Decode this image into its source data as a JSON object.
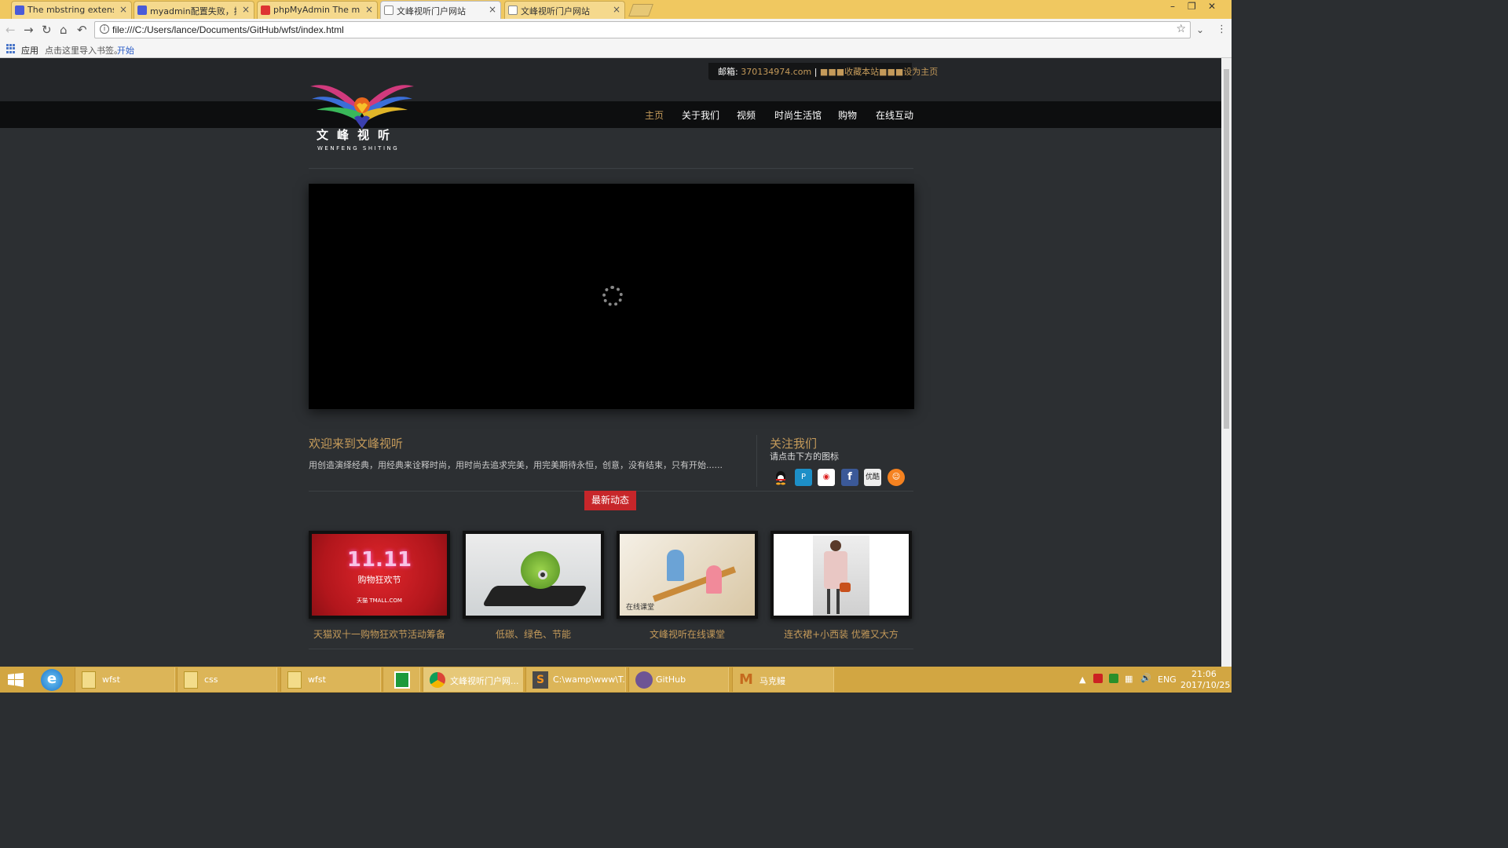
{
  "browser": {
    "tabs": [
      {
        "title": "The mbstring extensio",
        "active": false
      },
      {
        "title": "myadmin配置失败，提示",
        "active": false
      },
      {
        "title": "phpMyAdmin The mbs",
        "active": false
      },
      {
        "title": "文峰视听门户网站",
        "active": true
      },
      {
        "title": "文峰视听门户网站",
        "active": false
      }
    ],
    "close_glyph": "×",
    "url": "file:///C:/Users/lance/Documents/GitHub/wfst/index.html",
    "bookmarks": {
      "apps": "应用",
      "import_hint": "点击这里导入书签。",
      "start": "开始"
    }
  },
  "site": {
    "topbar": {
      "mail_label": "邮箱:",
      "mail_value": "370134974.com",
      "separator": "|",
      "links": "■■■收藏本站■■■设为主页"
    },
    "logo": {
      "name": "文峰视听",
      "subtitle": "WENFENG SHITING"
    },
    "nav": [
      "主页",
      "关于我们",
      "视频",
      "时尚生活馆",
      "购物",
      "在线互动"
    ],
    "welcome": {
      "title": "欢迎来到文峰视听",
      "text": "用创造演绎经典，用经典来诠释时尚，用时尚去追求完美，用完美期待永恒，创意，没有结束，只有开始......"
    },
    "follow": {
      "title": "关注我们",
      "subtitle": "请点击下方的图标",
      "icons": [
        "qq-icon",
        "pp-icon",
        "weibo-icon",
        "facebook-icon",
        "youku-icon",
        "renren-icon"
      ],
      "youku_label": "优酷"
    },
    "latest_button": "最新动态",
    "cards": [
      {
        "caption": "天猫双十一购物狂欢节活动筹备",
        "badge": "11.11",
        "badge_sub": "购物狂欢节",
        "brand": "天猫 TMALL.COM"
      },
      {
        "caption": "低碳、绿色、节能"
      },
      {
        "caption": "文峰视听在线课堂",
        "overlay": "在线课堂"
      },
      {
        "caption": "连衣裙+小西装 优雅又大方"
      }
    ]
  },
  "taskbar": {
    "items": [
      "wfst",
      "css",
      "wfst",
      "",
      "文峰视听门户网...",
      "C:\\wamp\\www\\T...",
      "GitHub",
      "马克鳗"
    ],
    "lang": "ENG",
    "time": "21:06",
    "date": "2017/10/25"
  },
  "colors": {
    "accent_gold": "#c49a5a",
    "latest_red": "#c7262a",
    "page_bg": "#2c2f32",
    "taskbar": "#d2a642",
    "tabbar": "#f0c860"
  }
}
